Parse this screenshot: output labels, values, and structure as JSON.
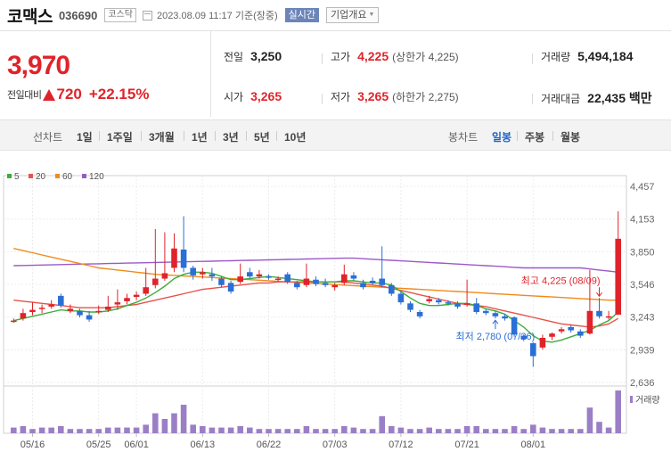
{
  "header": {
    "name": "코맥스",
    "code": "036690",
    "market": "코스닥",
    "datetime": "2023.08.09 11:17 기준(장중)",
    "realtime": "실시간",
    "company_info": "기업개요"
  },
  "quote": {
    "price": "3,970",
    "change_label": "전일대비",
    "change_abs": "720",
    "change_pct": "+22.15%",
    "prev_close_label": "전일",
    "prev_close": "3,250",
    "high_label": "고가",
    "high": "4,225",
    "upper_limit": "(상한가 4,225)",
    "volume_label": "거래량",
    "volume": "5,494,184",
    "open_label": "시가",
    "open": "3,265",
    "low_label": "저가",
    "low": "3,265",
    "lower_limit": "(하한가 2,275)",
    "amount_label": "거래대금",
    "amount": "22,435 백만"
  },
  "period_bar": {
    "line_chart_label": "선차트",
    "line_periods": [
      "1일",
      "1주일",
      "3개월",
      "1년",
      "3년",
      "5년",
      "10년"
    ],
    "candle_chart_label": "봉차트",
    "candle_periods": [
      "일봉",
      "주봉",
      "월봉"
    ],
    "active_candle": "일봉"
  },
  "colors": {
    "up": "#e0232a",
    "down": "#2a6fd6",
    "ma5": "#3aae3a",
    "ma20": "#e8524a",
    "ma60": "#f08a1c",
    "ma120": "#9b59c8",
    "volume": "#9b7fc6"
  },
  "chart_data": {
    "type": "candlestick",
    "legend": [
      "5",
      "20",
      "60",
      "120"
    ],
    "y_ticks": [
      4457,
      4153,
      3850,
      3546,
      3243,
      2939,
      2636
    ],
    "y_tick_labels": [
      "4,457",
      "4,153",
      "3,850",
      "3,546",
      "3,243",
      "2,939",
      "2,636"
    ],
    "ylim": [
      2636,
      4457
    ],
    "x_labels": [
      "05/16",
      "05/25",
      "06/01",
      "06/13",
      "06/22",
      "07/03",
      "07/12",
      "07/21",
      "08/01"
    ],
    "x_label_index": [
      2,
      9,
      13,
      20,
      27,
      34,
      41,
      48,
      55
    ],
    "volume_label": "거래량",
    "high_annotation": "최고 4,225 (08/09)",
    "low_annotation": "최저 2,780 (07/26)",
    "high_index": 62,
    "low_index": 51,
    "candles": [
      {
        "o": 3200,
        "c": 3210,
        "h": 3230,
        "l": 3190,
        "v": 4
      },
      {
        "o": 3230,
        "c": 3280,
        "h": 3320,
        "l": 3210,
        "v": 5
      },
      {
        "o": 3290,
        "c": 3310,
        "h": 3380,
        "l": 3260,
        "v": 3
      },
      {
        "o": 3320,
        "c": 3330,
        "h": 3360,
        "l": 3280,
        "v": 4
      },
      {
        "o": 3340,
        "c": 3360,
        "h": 3400,
        "l": 3320,
        "v": 4
      },
      {
        "o": 3440,
        "c": 3350,
        "h": 3460,
        "l": 3330,
        "v": 5
      },
      {
        "o": 3300,
        "c": 3320,
        "h": 3360,
        "l": 3280,
        "v": 3
      },
      {
        "o": 3300,
        "c": 3260,
        "h": 3320,
        "l": 3240,
        "v": 3
      },
      {
        "o": 3260,
        "c": 3220,
        "h": 3300,
        "l": 3200,
        "v": 3
      },
      {
        "o": 3290,
        "c": 3300,
        "h": 3350,
        "l": 3270,
        "v": 3
      },
      {
        "o": 3310,
        "c": 3340,
        "h": 3440,
        "l": 3290,
        "v": 4
      },
      {
        "o": 3360,
        "c": 3380,
        "h": 3500,
        "l": 3310,
        "v": 4
      },
      {
        "o": 3390,
        "c": 3420,
        "h": 3460,
        "l": 3360,
        "v": 4
      },
      {
        "o": 3430,
        "c": 3450,
        "h": 3480,
        "l": 3400,
        "v": 4
      },
      {
        "o": 3460,
        "c": 3520,
        "h": 3700,
        "l": 3440,
        "v": 6
      },
      {
        "o": 3540,
        "c": 3600,
        "h": 4060,
        "l": 3510,
        "v": 14
      },
      {
        "o": 3600,
        "c": 3650,
        "h": 4030,
        "l": 3580,
        "v": 10
      },
      {
        "o": 3700,
        "c": 3880,
        "h": 4020,
        "l": 3660,
        "v": 14
      },
      {
        "o": 3870,
        "c": 3700,
        "h": 4180,
        "l": 3660,
        "v": 20
      },
      {
        "o": 3700,
        "c": 3630,
        "h": 3720,
        "l": 3590,
        "v": 6
      },
      {
        "o": 3640,
        "c": 3660,
        "h": 3700,
        "l": 3600,
        "v": 5
      },
      {
        "o": 3640,
        "c": 3620,
        "h": 3700,
        "l": 3580,
        "v": 4
      },
      {
        "o": 3600,
        "c": 3540,
        "h": 3620,
        "l": 3520,
        "v": 4
      },
      {
        "o": 3560,
        "c": 3480,
        "h": 3580,
        "l": 3460,
        "v": 4
      },
      {
        "o": 3570,
        "c": 3620,
        "h": 3740,
        "l": 3550,
        "v": 5
      },
      {
        "o": 3660,
        "c": 3620,
        "h": 3700,
        "l": 3600,
        "v": 4
      },
      {
        "o": 3620,
        "c": 3640,
        "h": 3680,
        "l": 3600,
        "v": 3
      },
      {
        "o": 3620,
        "c": 3610,
        "h": 3640,
        "l": 3590,
        "v": 3
      },
      {
        "o": 3590,
        "c": 3600,
        "h": 3620,
        "l": 3570,
        "v": 3
      },
      {
        "o": 3640,
        "c": 3570,
        "h": 3660,
        "l": 3550,
        "v": 3
      },
      {
        "o": 3560,
        "c": 3520,
        "h": 3580,
        "l": 3500,
        "v": 3
      },
      {
        "o": 3540,
        "c": 3600,
        "h": 3740,
        "l": 3520,
        "v": 5
      },
      {
        "o": 3590,
        "c": 3550,
        "h": 3620,
        "l": 3530,
        "v": 3
      },
      {
        "o": 3560,
        "c": 3540,
        "h": 3600,
        "l": 3520,
        "v": 3
      },
      {
        "o": 3520,
        "c": 3540,
        "h": 3560,
        "l": 3490,
        "v": 3
      },
      {
        "o": 3560,
        "c": 3640,
        "h": 3730,
        "l": 3540,
        "v": 5
      },
      {
        "o": 3630,
        "c": 3600,
        "h": 3660,
        "l": 3580,
        "v": 4
      },
      {
        "o": 3560,
        "c": 3520,
        "h": 3590,
        "l": 3500,
        "v": 3
      },
      {
        "o": 3580,
        "c": 3560,
        "h": 3610,
        "l": 3540,
        "v": 3
      },
      {
        "o": 3600,
        "c": 3540,
        "h": 3900,
        "l": 3520,
        "v": 12
      },
      {
        "o": 3540,
        "c": 3460,
        "h": 3560,
        "l": 3440,
        "v": 5
      },
      {
        "o": 3460,
        "c": 3380,
        "h": 3480,
        "l": 3360,
        "v": 4
      },
      {
        "o": 3370,
        "c": 3310,
        "h": 3390,
        "l": 3290,
        "v": 3
      },
      {
        "o": 3290,
        "c": 3250,
        "h": 3310,
        "l": 3230,
        "v": 3
      },
      {
        "o": 3390,
        "c": 3410,
        "h": 3440,
        "l": 3370,
        "v": 4
      },
      {
        "o": 3400,
        "c": 3380,
        "h": 3420,
        "l": 3360,
        "v": 3
      },
      {
        "o": 3380,
        "c": 3370,
        "h": 3400,
        "l": 3350,
        "v": 3
      },
      {
        "o": 3370,
        "c": 3340,
        "h": 3390,
        "l": 3320,
        "v": 3
      },
      {
        "o": 3360,
        "c": 3370,
        "h": 3590,
        "l": 3340,
        "v": 5
      },
      {
        "o": 3370,
        "c": 3290,
        "h": 3420,
        "l": 3270,
        "v": 5
      },
      {
        "o": 3300,
        "c": 3280,
        "h": 3320,
        "l": 3260,
        "v": 3
      },
      {
        "o": 3280,
        "c": 3250,
        "h": 3300,
        "l": 3230,
        "v": 3
      },
      {
        "o": 3250,
        "c": 3230,
        "h": 3270,
        "l": 3210,
        "v": 3
      },
      {
        "o": 3240,
        "c": 3080,
        "h": 3250,
        "l": 3060,
        "v": 5
      },
      {
        "o": 3070,
        "c": 3040,
        "h": 3080,
        "l": 3020,
        "v": 3
      },
      {
        "o": 3000,
        "c": 2880,
        "h": 3010,
        "l": 2780,
        "v": 6
      },
      {
        "o": 2960,
        "c": 3050,
        "h": 3080,
        "l": 2940,
        "v": 4
      },
      {
        "o": 3060,
        "c": 3090,
        "h": 3100,
        "l": 3030,
        "v": 3
      },
      {
        "o": 3110,
        "c": 3130,
        "h": 3150,
        "l": 3090,
        "v": 3
      },
      {
        "o": 3150,
        "c": 3120,
        "h": 3170,
        "l": 3100,
        "v": 3
      },
      {
        "o": 3110,
        "c": 3070,
        "h": 3130,
        "l": 3050,
        "v": 3
      },
      {
        "o": 3090,
        "c": 3300,
        "h": 3680,
        "l": 3080,
        "v": 18
      },
      {
        "o": 3300,
        "c": 3250,
        "h": 3420,
        "l": 3230,
        "v": 8
      },
      {
        "o": 3250,
        "c": 3250,
        "h": 3300,
        "l": 3220,
        "v": 4
      },
      {
        "o": 3265,
        "c": 3970,
        "h": 4225,
        "l": 3265,
        "v": 30
      }
    ],
    "ma5": [
      3210,
      3230,
      3250,
      3270,
      3290,
      3310,
      3300,
      3300,
      3290,
      3290,
      3300,
      3320,
      3350,
      3380,
      3420,
      3470,
      3530,
      3600,
      3640,
      3660,
      3660,
      3650,
      3620,
      3590,
      3590,
      3600,
      3610,
      3620,
      3610,
      3600,
      3590,
      3580,
      3570,
      3570,
      3570,
      3580,
      3580,
      3570,
      3560,
      3560,
      3540,
      3480,
      3420,
      3370,
      3350,
      3350,
      3360,
      3370,
      3370,
      3350,
      3320,
      3300,
      3270,
      3210,
      3150,
      3070,
      3020,
      3010,
      3030,
      3060,
      3090,
      3120,
      3170,
      3210,
      3290
    ],
    "ma20": [
      3400,
      3390,
      3380,
      3370,
      3360,
      3350,
      3340,
      3330,
      3330,
      3330,
      3330,
      3340,
      3350,
      3360,
      3380,
      3400,
      3420,
      3440,
      3460,
      3480,
      3500,
      3510,
      3520,
      3530,
      3540,
      3550,
      3560,
      3560,
      3570,
      3570,
      3570,
      3570,
      3570,
      3570,
      3570,
      3570,
      3560,
      3550,
      3540,
      3530,
      3510,
      3490,
      3470,
      3450,
      3430,
      3410,
      3390,
      3370,
      3360,
      3350,
      3340,
      3320,
      3300,
      3280,
      3260,
      3240,
      3220,
      3200,
      3180,
      3170,
      3160,
      3150,
      3160,
      3180,
      3230
    ],
    "ma60": [
      3880,
      3860,
      3840,
      3820,
      3800,
      3780,
      3760,
      3740,
      3720,
      3700,
      3690,
      3680,
      3670,
      3660,
      3650,
      3640,
      3635,
      3630,
      3625,
      3620,
      3615,
      3610,
      3605,
      3600,
      3595,
      3590,
      3585,
      3580,
      3575,
      3570,
      3565,
      3560,
      3555,
      3550,
      3545,
      3540,
      3535,
      3530,
      3525,
      3520,
      3515,
      3510,
      3505,
      3500,
      3495,
      3490,
      3485,
      3480,
      3475,
      3470,
      3465,
      3460,
      3455,
      3450,
      3445,
      3440,
      3435,
      3430,
      3425,
      3420,
      3415,
      3410,
      3405,
      3400,
      3400
    ],
    "ma120": [
      3720,
      3722,
      3724,
      3726,
      3728,
      3730,
      3732,
      3734,
      3736,
      3738,
      3740,
      3742,
      3744,
      3746,
      3748,
      3750,
      3752,
      3754,
      3756,
      3758,
      3760,
      3762,
      3764,
      3766,
      3768,
      3770,
      3772,
      3774,
      3776,
      3778,
      3780,
      3782,
      3784,
      3786,
      3788,
      3790,
      3790,
      3785,
      3780,
      3775,
      3770,
      3765,
      3760,
      3755,
      3750,
      3745,
      3740,
      3735,
      3730,
      3725,
      3720,
      3715,
      3710,
      3705,
      3700,
      3700,
      3700,
      3700,
      3700,
      3700,
      3700,
      3690,
      3680,
      3670,
      3660
    ]
  }
}
